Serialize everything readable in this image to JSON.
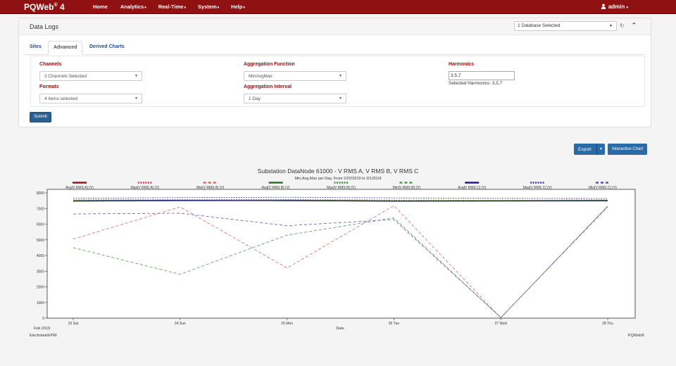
{
  "nav": {
    "brand": "PQWeb",
    "brand_sup": "®",
    "brand_version": " 4",
    "items": [
      {
        "label": "Home",
        "caret": ""
      },
      {
        "label": "Analytics",
        "caret": "▾"
      },
      {
        "label": "Real-Time",
        "caret": "▾"
      },
      {
        "label": "System",
        "caret": "▾"
      },
      {
        "label": "Help",
        "caret": "▾"
      }
    ],
    "user_icon": "user-icon",
    "user": "admin",
    "user_caret": "▾"
  },
  "panel": {
    "title": "Data Logs",
    "database_select": "1 Database Selected",
    "refresh_icon": "refresh-icon",
    "collapse_icon": "chevron-up-icon"
  },
  "tabs": [
    {
      "label": "Sites",
      "active": false
    },
    {
      "label": "Advanced",
      "active": true
    },
    {
      "label": "Derived Charts",
      "active": false
    }
  ],
  "form": {
    "channels_label": "Channels",
    "channels_value": "3 Channels Selected",
    "formats_label": "Formats",
    "formats_value": "4 items selected",
    "aggfunc_label": "Aggregation Function",
    "aggfunc_value": "MinAvgMax",
    "agginterval_label": "Aggregation Interval",
    "agginterval_value": "1 Day",
    "harmonics_label": "Harmonics",
    "harmonics_value": "3,5,7",
    "harmonics_note": "Selected Harmonics: 3,5,7",
    "submit_label": "Submit"
  },
  "actions": {
    "export_label": "Export",
    "interactive_label": "Interactive Chart"
  },
  "chart_data": {
    "type": "line",
    "title": "Substation DataNode 61000 - V RMS A, V RMS B, V RMS C",
    "subtitle": "Min,Avg,Max per Day, From 2/22/2019 to 3/1/2019",
    "xlabel": "Date",
    "x_sublabel": "Feb 2019",
    "ylabel": "",
    "categories": [
      "23 Sat",
      "24 Sun",
      "25 Mon",
      "26 Tue",
      "27 Wed",
      "28 Thu"
    ],
    "yticks": [
      "8000",
      "7000",
      "6000",
      "5000",
      "4000",
      "3000",
      "2000",
      "1000",
      "0"
    ],
    "ylim": [
      0,
      8000
    ],
    "grid": false,
    "legend_position": "top",
    "footer_left": "Electrotek/EPRI",
    "footer_right": "PQWeb®",
    "series": [
      {
        "name": "Avg[V RMS A] (V)",
        "color": "#8b1a1a",
        "dash": "solid",
        "values": [
          7480,
          7510,
          7520,
          7480,
          7490,
          7510
        ]
      },
      {
        "name": "Max[V RMS A] (V)",
        "color": "#c94040",
        "dash": "dotted",
        "values": [
          7550,
          7560,
          7570,
          7540,
          7530,
          7550
        ]
      },
      {
        "name": "Min[V RMS A] (V)",
        "color": "#e06060",
        "dash": "dashed",
        "values": [
          5050,
          7100,
          3200,
          7180,
          20,
          7150
        ]
      },
      {
        "name": "Avg[V RMS B] (V)",
        "color": "#2f6b2f",
        "dash": "solid",
        "values": [
          7470,
          7500,
          7510,
          7470,
          7480,
          7500
        ]
      },
      {
        "name": "Max[V RMS B] (V)",
        "color": "#3d8a3d",
        "dash": "dotted",
        "values": [
          7540,
          7550,
          7560,
          7530,
          7520,
          7540
        ]
      },
      {
        "name": "Min[V RMS B] (V)",
        "color": "#4a9a4a",
        "dash": "dashed",
        "values": [
          4500,
          2800,
          5300,
          6400,
          30,
          7100
        ]
      },
      {
        "name": "Avg[V RMS C] (V)",
        "color": "#1c1c8b",
        "dash": "solid",
        "values": [
          7490,
          7520,
          7500,
          7470,
          7480,
          7490
        ]
      },
      {
        "name": "Max[V RMS C] (V)",
        "color": "#3a3ab0",
        "dash": "dotted",
        "values": [
          7650,
          7700,
          7720,
          7680,
          7650,
          7640
        ]
      },
      {
        "name": "Min[V RMS C] (V)",
        "color": "#5555c0",
        "dash": "dashed",
        "values": [
          6650,
          6700,
          5900,
          6300,
          40,
          7150
        ]
      }
    ]
  }
}
